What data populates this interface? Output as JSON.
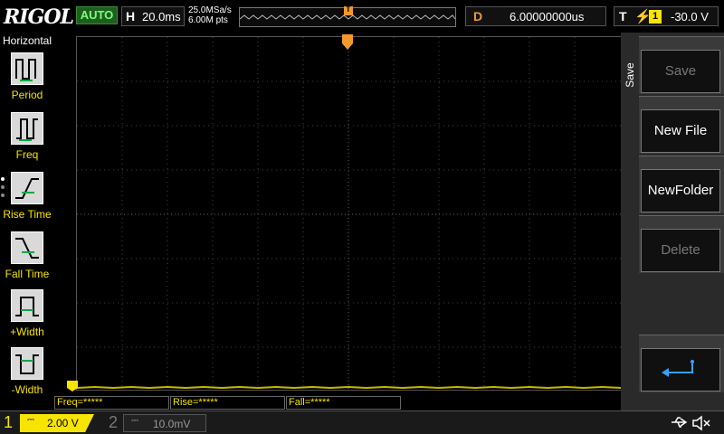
{
  "brand": "RIGOL",
  "run_status": "AUTO",
  "horizontal": {
    "label": "H",
    "timebase": "20.0ms"
  },
  "acquisition": {
    "sample_rate": "25.0MSa/s",
    "memory_depth": "6.00M pts"
  },
  "delay": {
    "label": "D",
    "value": "6.00000000us"
  },
  "trigger": {
    "label": "T",
    "edge_glyph": "⚡",
    "source": "1",
    "level": "-30.0 V",
    "marker_color": "#f39a2b"
  },
  "left_menu": {
    "title": "Horizontal",
    "items": [
      {
        "label": "Period",
        "icon": "period-icon"
      },
      {
        "label": "Freq",
        "icon": "freq-icon"
      },
      {
        "label": "Rise Time",
        "icon": "rise-time-icon"
      },
      {
        "label": "Fall Time",
        "icon": "fall-time-icon"
      },
      {
        "label": "+Width",
        "icon": "positive-width-icon"
      },
      {
        "label": "-Width",
        "icon": "negative-width-icon"
      }
    ]
  },
  "right_menu": {
    "title": "Save",
    "buttons": [
      {
        "label": "Save",
        "enabled": false
      },
      {
        "label": "New File",
        "enabled": true
      },
      {
        "label": "NewFolder",
        "enabled": true
      },
      {
        "label": "Delete",
        "enabled": false
      },
      {
        "label": "",
        "icon": "enter-return-icon",
        "enabled": true
      }
    ]
  },
  "measurements": [
    {
      "label": "Freq=*****"
    },
    {
      "label": "Rise=*****"
    },
    {
      "label": "Fall=*****"
    }
  ],
  "channels": [
    {
      "number": "1",
      "coupling": "⎓",
      "scale": "2.00 V",
      "active": true,
      "color": "#f7e400"
    },
    {
      "number": "2",
      "coupling": "⎓",
      "scale": "10.0mV",
      "active": false,
      "color": "#777777"
    }
  ],
  "status_icons": {
    "usb": "usb-icon",
    "sound": "speaker-muted-icon"
  },
  "colors": {
    "ch1": "#f7e400",
    "trigger": "#f39a2b",
    "grid": "#555555"
  }
}
